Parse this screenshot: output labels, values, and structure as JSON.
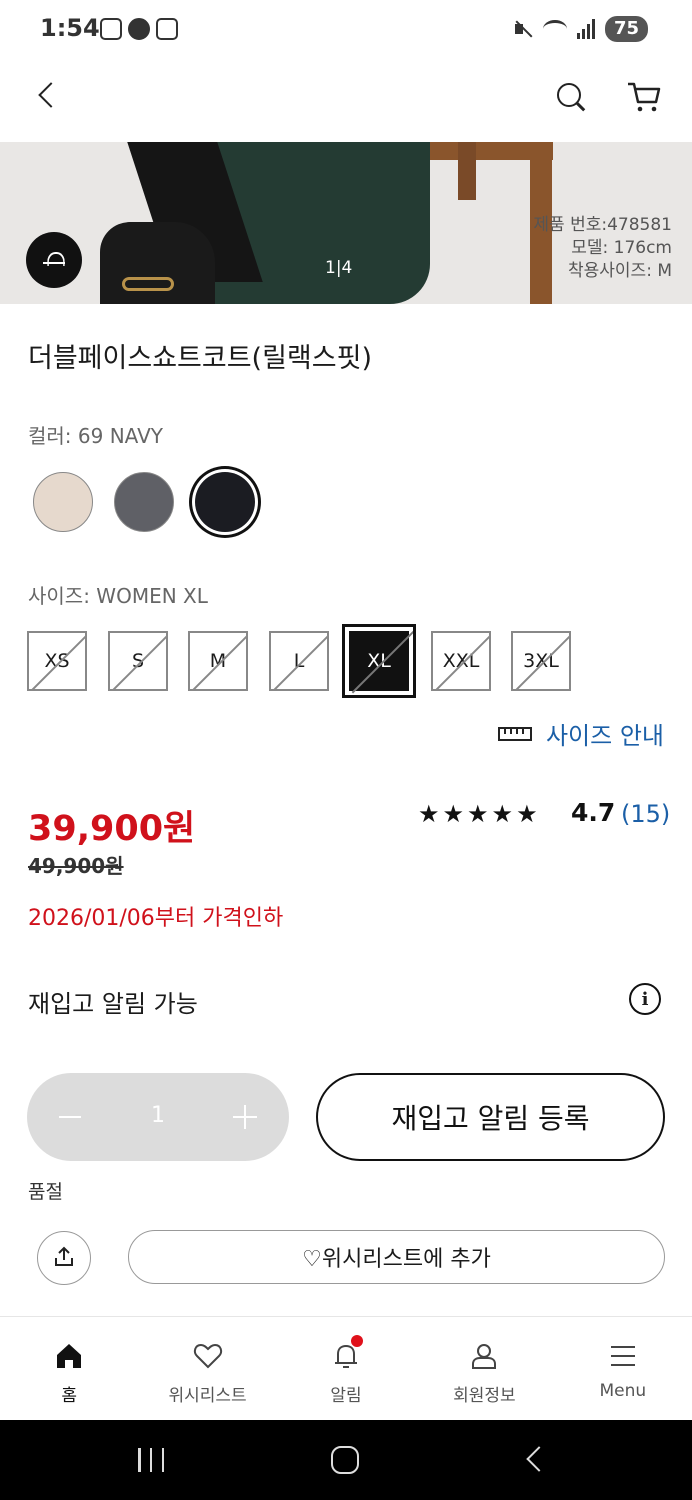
{
  "status_bar": {
    "time": "1:54",
    "battery": "75"
  },
  "hero": {
    "counter": "1|4",
    "meta_line1": "제품 번호:478581",
    "meta_line2": "모델: 176cm",
    "meta_line3": "착용사이즈: M"
  },
  "product": {
    "name": "더블페이스쇼트코트(릴랙스핏)",
    "color_label": "컬러: 69 NAVY",
    "colors": [
      {
        "name": "beige",
        "hex": "#e6d9cd"
      },
      {
        "name": "gray",
        "hex": "#5f6066"
      },
      {
        "name": "navy",
        "hex": "#1b1c22"
      }
    ],
    "selected_color_index": 2,
    "size_label": "사이즈: WOMEN XL",
    "sizes": [
      "XS",
      "S",
      "M",
      "L",
      "XL",
      "XXL",
      "3XL"
    ],
    "selected_size": "XL",
    "size_guide_label": "사이즈 안내",
    "price": "39,900원",
    "old_price": "49,900원",
    "stars": "★★★★★",
    "rating": "4.7",
    "review_count": "(15)",
    "discount_date": "2026/01/06부터 가격인하",
    "restock_text": "재입고 알림 가능",
    "quantity": "1",
    "restock_button": "재입고 알림 등록",
    "soldout": "품절",
    "wishlist_button": "♡위시리스트에 추가"
  },
  "bottom_nav": {
    "items": [
      {
        "label": "홈"
      },
      {
        "label": "위시리스트"
      },
      {
        "label": "알림"
      },
      {
        "label": "회원정보"
      },
      {
        "label": "Menu"
      }
    ]
  },
  "colors": {
    "price_red": "#d0111b",
    "link_blue": "#1b5fa7"
  }
}
